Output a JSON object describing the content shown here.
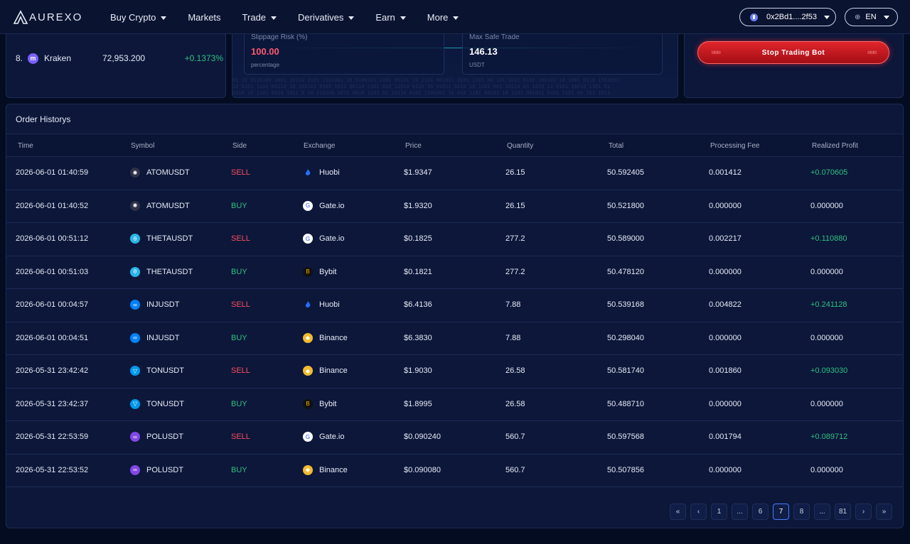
{
  "brand": {
    "logo_text": "AUREXO"
  },
  "nav": {
    "items": [
      {
        "label": "Buy Crypto",
        "has_caret": true
      },
      {
        "label": "Markets",
        "has_caret": false
      },
      {
        "label": "Trade",
        "has_caret": true
      },
      {
        "label": "Derivatives",
        "has_caret": true
      },
      {
        "label": "Earn",
        "has_caret": true
      },
      {
        "label": "More",
        "has_caret": true
      }
    ],
    "wallet": "0x2Bd1....2f53",
    "language": "EN"
  },
  "ranking": {
    "row": {
      "rank": "8.",
      "name": "Kraken",
      "price": "72,953.200",
      "change": "+0.1373%"
    }
  },
  "metrics": [
    {
      "label": "Slippage Risk (%)",
      "value": "100.00",
      "unit": "percentage"
    },
    {
      "label": "Max Safe Trade",
      "value": "146.13",
      "unit": "USDT"
    }
  ],
  "bot": {
    "stop_label": "Stop Trading Bot"
  },
  "orders": {
    "title": "Order Historys",
    "columns": [
      "Time",
      "Symbol",
      "Side",
      "Exchange",
      "Price",
      "Quantity",
      "Total",
      "Processing Fee",
      "Realized Profit"
    ],
    "rows": [
      {
        "time": "2026-06-01 01:40:59",
        "symbol": "ATOMUSDT",
        "side": "SELL",
        "exchange": "Huobi",
        "price": "$1.9347",
        "quantity": "26.15",
        "total": "50.592405",
        "fee": "0.001412",
        "profit": "+0.070605"
      },
      {
        "time": "2026-06-01 01:40:52",
        "symbol": "ATOMUSDT",
        "side": "BUY",
        "exchange": "Gate.io",
        "price": "$1.9320",
        "quantity": "26.15",
        "total": "50.521800",
        "fee": "0.000000",
        "profit": "0.000000"
      },
      {
        "time": "2026-06-01 00:51:12",
        "symbol": "THETAUSDT",
        "side": "SELL",
        "exchange": "Gate.io",
        "price": "$0.1825",
        "quantity": "277.2",
        "total": "50.589000",
        "fee": "0.002217",
        "profit": "+0.110880"
      },
      {
        "time": "2026-06-01 00:51:03",
        "symbol": "THETAUSDT",
        "side": "BUY",
        "exchange": "Bybit",
        "price": "$0.1821",
        "quantity": "277.2",
        "total": "50.478120",
        "fee": "0.000000",
        "profit": "0.000000"
      },
      {
        "time": "2026-06-01 00:04:57",
        "symbol": "INJUSDT",
        "side": "SELL",
        "exchange": "Huobi",
        "price": "$6.4136",
        "quantity": "7.88",
        "total": "50.539168",
        "fee": "0.004822",
        "profit": "+0.241128"
      },
      {
        "time": "2026-06-01 00:04:51",
        "symbol": "INJUSDT",
        "side": "BUY",
        "exchange": "Binance",
        "price": "$6.3830",
        "quantity": "7.88",
        "total": "50.298040",
        "fee": "0.000000",
        "profit": "0.000000"
      },
      {
        "time": "2026-05-31 23:42:42",
        "symbol": "TONUSDT",
        "side": "SELL",
        "exchange": "Binance",
        "price": "$1.9030",
        "quantity": "26.58",
        "total": "50.581740",
        "fee": "0.001860",
        "profit": "+0.093030"
      },
      {
        "time": "2026-05-31 23:42:37",
        "symbol": "TONUSDT",
        "side": "BUY",
        "exchange": "Bybit",
        "price": "$1.8995",
        "quantity": "26.58",
        "total": "50.488710",
        "fee": "0.000000",
        "profit": "0.000000"
      },
      {
        "time": "2026-05-31 22:53:59",
        "symbol": "POLUSDT",
        "side": "SELL",
        "exchange": "Gate.io",
        "price": "$0.090240",
        "quantity": "560.7",
        "total": "50.597568",
        "fee": "0.001794",
        "profit": "+0.089712"
      },
      {
        "time": "2026-05-31 22:53:52",
        "symbol": "POLUSDT",
        "side": "BUY",
        "exchange": "Binance",
        "price": "$0.090080",
        "quantity": "560.7",
        "total": "50.507856",
        "fee": "0.000000",
        "profit": "0.000000"
      }
    ]
  },
  "pagination": {
    "items": [
      "«",
      "‹",
      "1",
      "...",
      "6",
      "7",
      "8",
      "...",
      "81",
      "›",
      "»"
    ],
    "active": "7"
  },
  "colors": {
    "sell": "#ff4d5e",
    "buy": "#2ec27e",
    "accent": "#4a7dff",
    "coins": {
      "ATOMUSDT": "#2e3148",
      "THETAUSDT": "#29b6e8",
      "INJUSDT": "#0082fa",
      "TONUSDT": "#0098ea",
      "POLUSDT": "#8247e5"
    },
    "exchanges": {
      "Huobi": "#1a5cf4",
      "Gate.io": "#2354e6",
      "Bybit": "#111111",
      "Binance": "#f3ba2f"
    }
  },
  "icons": {
    "coins": {
      "ATOMUSDT": "atom-icon",
      "THETAUSDT": "theta-icon",
      "INJUSDT": "injective-icon",
      "TONUSDT": "ton-icon",
      "POLUSDT": "polygon-icon"
    },
    "exchanges": {
      "Huobi": "huobi-flame-icon",
      "Gate.io": "gateio-icon",
      "Bybit": "bybit-icon",
      "Binance": "binance-icon"
    }
  }
}
